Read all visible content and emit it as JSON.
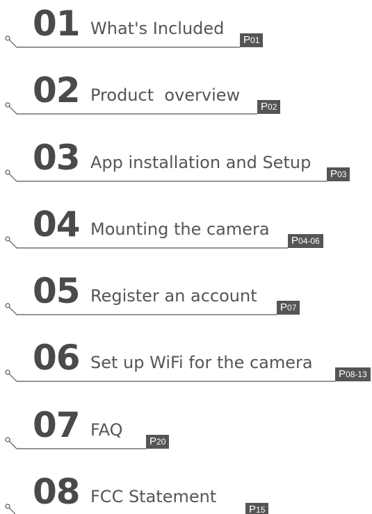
{
  "toc": {
    "entries": [
      {
        "number": "01",
        "title": "What's Included",
        "page_prefix": "P",
        "page": "01"
      },
      {
        "number": "02",
        "title": "Product  overview",
        "page_prefix": "P",
        "page": "02"
      },
      {
        "number": "03",
        "title": "App installation and Setup",
        "page_prefix": "P",
        "page": "03"
      },
      {
        "number": "04",
        "title": "Mounting the camera",
        "page_prefix": "P",
        "page": "04-06"
      },
      {
        "number": "05",
        "title": "Register an account",
        "page_prefix": "P",
        "page": "07"
      },
      {
        "number": "06",
        "title": "Set up WiFi for the camera",
        "page_prefix": "P",
        "page": "08-13"
      },
      {
        "number": "07",
        "title": "FAQ",
        "page_prefix": "P",
        "page": "20"
      },
      {
        "number": "08",
        "title": "FCC Statement",
        "page_prefix": "P",
        "page": "15"
      }
    ]
  },
  "colors": {
    "number": "#4a4a4a",
    "title": "#555555",
    "line": "#555555",
    "badge_bg": "#555555",
    "badge_text": "#ffffff"
  }
}
